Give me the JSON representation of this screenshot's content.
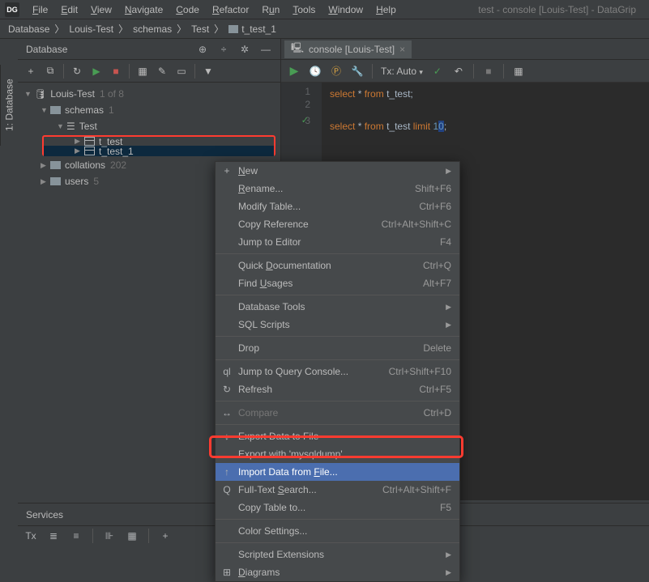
{
  "app": {
    "title": "test - console [Louis-Test] - DataGrip",
    "logo": "DG"
  },
  "menu": [
    "File",
    "Edit",
    "View",
    "Navigate",
    "Code",
    "Refactor",
    "Run",
    "Tools",
    "Window",
    "Help"
  ],
  "breadcrumb": [
    "Database",
    "Louis-Test",
    "schemas",
    "Test",
    "t_test_1"
  ],
  "db_panel": {
    "title": "Database",
    "tree": {
      "root": {
        "label": "Louis-Test",
        "count": "1 of 8"
      },
      "schemas": {
        "label": "schemas",
        "count": "1"
      },
      "test_schema": {
        "label": "Test"
      },
      "t_test": {
        "label": "t_test"
      },
      "t_test_1": {
        "label": "t_test_1"
      },
      "collations": {
        "label": "collations",
        "count": "202"
      },
      "users": {
        "label": "users",
        "count": "5"
      }
    }
  },
  "sidebar_tab": "1: Database",
  "editor": {
    "tab_label": "console [Louis-Test]",
    "tx_label": "Tx: Auto",
    "lines": {
      "l1": {
        "num": "1",
        "sql": {
          "k1": "select",
          "star": "*",
          "k2": "from",
          "t": "t_test",
          "semi": ";"
        }
      },
      "l2": {
        "num": "2"
      },
      "l3": {
        "num": "3",
        "sql": {
          "k1": "select",
          "star": "*",
          "k2": "from",
          "t": "t_test",
          "k3": "limit",
          "n1": "1",
          "n2": "0",
          "semi": ";"
        }
      }
    }
  },
  "context_menu": [
    {
      "label": "New",
      "underline": 0,
      "submenu": true,
      "icon": "+"
    },
    {
      "label": "Rename...",
      "underline": 0,
      "shortcut": "Shift+F6"
    },
    {
      "label": "Modify Table...",
      "shortcut": "Ctrl+F6"
    },
    {
      "label": "Copy Reference",
      "shortcut": "Ctrl+Alt+Shift+C"
    },
    {
      "label": "Jump to Editor",
      "shortcut": "F4"
    },
    {
      "sep": true
    },
    {
      "label": "Quick Documentation",
      "underline": 6,
      "shortcut": "Ctrl+Q"
    },
    {
      "label": "Find Usages",
      "underline": 5,
      "shortcut": "Alt+F7"
    },
    {
      "sep": true
    },
    {
      "label": "Database Tools",
      "submenu": true
    },
    {
      "label": "SQL Scripts",
      "submenu": true
    },
    {
      "sep": true
    },
    {
      "label": "Drop",
      "shortcut": "Delete"
    },
    {
      "sep": true
    },
    {
      "label": "Jump to Query Console...",
      "shortcut": "Ctrl+Shift+F10",
      "icon": "ql"
    },
    {
      "label": "Refresh",
      "shortcut": "Ctrl+F5",
      "icon": "↻"
    },
    {
      "sep": true
    },
    {
      "label": "Compare",
      "shortcut": "Ctrl+D",
      "icon": "↔",
      "disabled": true
    },
    {
      "sep": true
    },
    {
      "label": "Export Data to File",
      "icon": "↓"
    },
    {
      "label": "Export with 'mysqldump'"
    },
    {
      "label": "Import Data from File...",
      "underline": 17,
      "icon": "↑",
      "highlighted": true
    },
    {
      "label": "Full-Text Search...",
      "underline": 10,
      "shortcut": "Ctrl+Alt+Shift+F",
      "icon": "Q"
    },
    {
      "label": "Copy Table to...",
      "shortcut": "F5"
    },
    {
      "sep": true
    },
    {
      "label": "Color Settings..."
    },
    {
      "sep": true
    },
    {
      "label": "Scripted Extensions",
      "submenu": true
    },
    {
      "label": "Diagrams",
      "underline": 0,
      "submenu": true,
      "icon": "⊞"
    }
  ],
  "services": {
    "title": "Services"
  }
}
